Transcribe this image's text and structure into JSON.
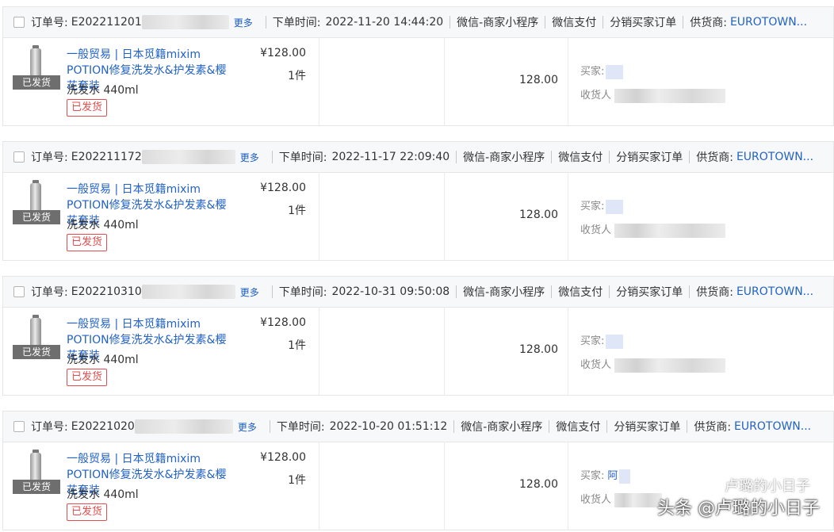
{
  "labels": {
    "order_no": "订单号:",
    "more": "更多",
    "order_time": "下单时间:",
    "channel": "微信-商家小程序",
    "payment": "微信支付",
    "order_type": "分销买家订单",
    "supplier": "供货商:",
    "supplier_name": "EUROTOWN...",
    "ship_tag": "已发货",
    "buyer": "买家:",
    "receiver": "收货人"
  },
  "orders": [
    {
      "order_no": "E202211201",
      "order_time": "2022-11-20 14:44:20",
      "product_title": "一般贸易 | 日本觅籍mixim POTION修复洗发水&护发素&樱花套装",
      "spec": "洗发水 440ml",
      "status": "已发货",
      "price": "¥128.00",
      "qty": "1件",
      "total": "128.00",
      "buyer_name": ""
    },
    {
      "order_no": "E202211172",
      "order_time": "2022-11-17 22:09:40",
      "product_title": "一般贸易 | 日本觅籍mixim POTION修复洗发水&护发素&樱花套装",
      "spec": "洗发水 440ml",
      "status": "已发货",
      "price": "¥128.00",
      "qty": "1件",
      "total": "128.00",
      "buyer_name": ""
    },
    {
      "order_no": "E202210310",
      "order_time": "2022-10-31 09:50:08",
      "product_title": "一般贸易 | 日本觅籍mixim POTION修复洗发水&护发素&樱花套装",
      "spec": "洗发水 440ml",
      "status": "已发货",
      "price": "¥128.00",
      "qty": "1件",
      "total": "128.00",
      "buyer_name": ""
    },
    {
      "order_no": "E20221020",
      "order_time": "2022-10-20 01:51:12",
      "product_title": "一般贸易 | 日本觅籍mixim POTION修复洗发水&护发素&樱花套装",
      "spec": "洗发水 440ml",
      "status": "已发货",
      "price": "¥128.00",
      "qty": "1件",
      "total": "128.00",
      "buyer_name": "阿"
    }
  ],
  "watermark": {
    "line1": "卢璐的小日子",
    "line2": "头条 @卢璐的小日子"
  },
  "colors": {
    "link": "#2262c6",
    "status": "#e34d4d",
    "header_bg": "#f7f8fa",
    "border": "#e6e6e6"
  }
}
